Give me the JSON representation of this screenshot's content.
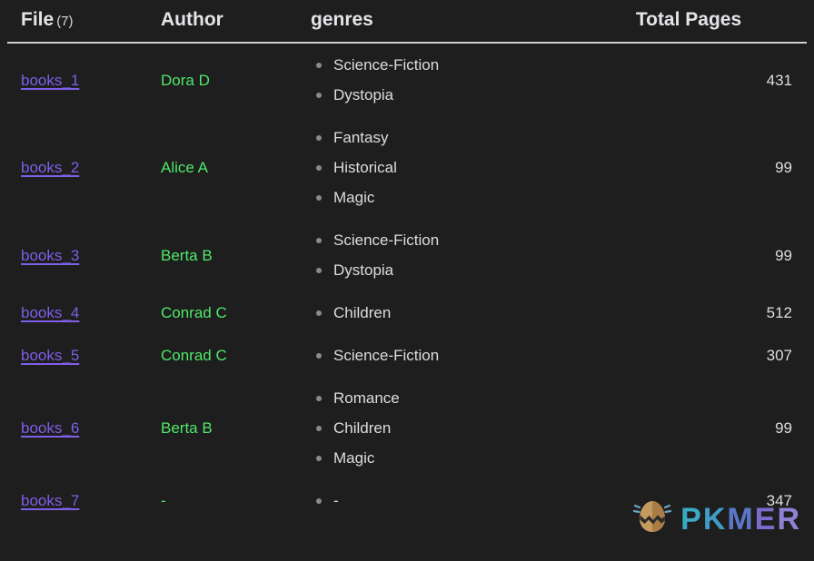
{
  "table": {
    "columns": [
      {
        "key": "file",
        "label": "File",
        "count": "(7)"
      },
      {
        "key": "author",
        "label": "Author",
        "count": ""
      },
      {
        "key": "genres",
        "label": "genres",
        "count": ""
      },
      {
        "key": "pages",
        "label": "Total Pages",
        "count": ""
      }
    ],
    "rows": [
      {
        "file": "books_1",
        "author": "Dora D",
        "genres": [
          "Science-Fiction",
          "Dystopia"
        ],
        "pages": "431"
      },
      {
        "file": "books_2",
        "author": "Alice A",
        "genres": [
          "Fantasy",
          "Historical",
          "Magic"
        ],
        "pages": "99"
      },
      {
        "file": "books_3",
        "author": "Berta B",
        "genres": [
          "Science-Fiction",
          "Dystopia"
        ],
        "pages": "99"
      },
      {
        "file": "books_4",
        "author": "Conrad C",
        "genres": [
          "Children"
        ],
        "pages": "512"
      },
      {
        "file": "books_5",
        "author": "Conrad C",
        "genres": [
          "Science-Fiction"
        ],
        "pages": "307"
      },
      {
        "file": "books_6",
        "author": "Berta B",
        "genres": [
          "Romance",
          "Children",
          "Magic"
        ],
        "pages": "99"
      },
      {
        "file": "books_7",
        "author": "-",
        "genres": [
          "-"
        ],
        "pages": "347"
      }
    ]
  },
  "watermark": {
    "icon": "cracked-egg-icon",
    "letters": [
      "P",
      "K",
      "M",
      "E",
      "R"
    ],
    "text": "PKMER"
  },
  "colors": {
    "background": "#1e1e1e",
    "link": "#7d5fe8",
    "author": "#4fe869",
    "text": "#dcdde0",
    "header_rule": "#cfd0d2",
    "bullet": "#8a8a8a"
  }
}
